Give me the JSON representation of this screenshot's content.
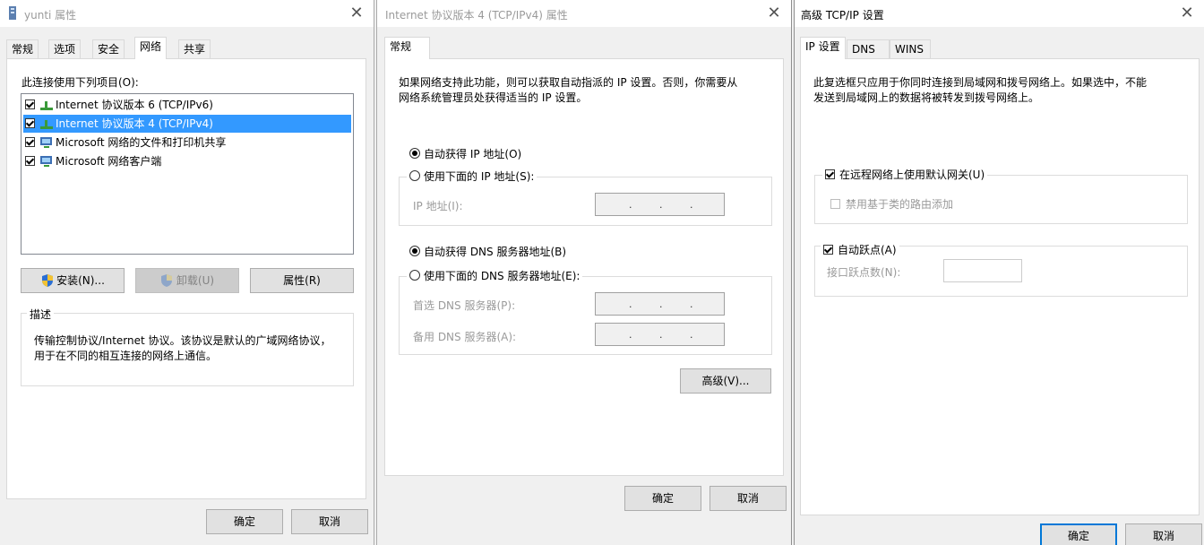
{
  "win1": {
    "title": "yunti 属性",
    "tabs": [
      "常规",
      "选项",
      "安全",
      "网络",
      "共享"
    ],
    "list_label": "此连接使用下列项目(O):",
    "items": [
      {
        "label": "Internet 协议版本 6 (TCP/IPv6)",
        "checked": true
      },
      {
        "label": "Internet 协议版本 4 (TCP/IPv4)",
        "checked": true
      },
      {
        "label": "Microsoft 网络的文件和打印机共享",
        "checked": true
      },
      {
        "label": "Microsoft 网络客户端",
        "checked": true
      }
    ],
    "install_label": "安装(N)...",
    "uninstall_label": "卸载(U)",
    "properties_label": "属性(R)",
    "desc_title": "描述",
    "desc_line1": "传输控制协议/Internet 协议。该协议是默认的广域网络协议，",
    "desc_line2": "用于在不同的相互连接的网络上通信。",
    "ok_label": "确定",
    "cancel_label": "取消"
  },
  "win2": {
    "title": "Internet 协议版本 4 (TCP/IPv4) 属性",
    "tab": "常规",
    "intro_line1": "如果网络支持此功能，则可以获取自动指派的 IP 设置。否则，你需要从",
    "intro_line2": "网络系统管理员处获得适当的 IP 设置。",
    "auto_ip": "自动获得 IP 地址(O)",
    "manual_ip": "使用下面的 IP 地址(S):",
    "ip_label": "IP 地址(I):",
    "auto_dns": "自动获得 DNS 服务器地址(B)",
    "manual_dns": "使用下面的 DNS 服务器地址(E):",
    "pref_dns": "首选 DNS 服务器(P):",
    "alt_dns": "备用 DNS 服务器(A):",
    "advanced_label": "高级(V)...",
    "ok_label": "确定",
    "cancel_label": "取消"
  },
  "win3": {
    "title": "高级 TCP/IP 设置",
    "tabs": [
      "IP 设置",
      "DNS",
      "WINS"
    ],
    "desc_line1": "此复选框只应用于你同时连接到局域网和拨号网络上。如果选中，不能",
    "desc_line2": "发送到局域网上的数据将被转发到拨号网络上。",
    "use_gateway": "在远程网络上使用默认网关(U)",
    "disable_class": "禁用基于类的路由添加",
    "auto_metric": "自动跃点(A)",
    "metric_label": "接口跃点数(N):",
    "ok_label": "确定",
    "cancel_label": "取消"
  },
  "colors": {
    "selection": "#3399ff",
    "panel": "#ffffff",
    "dialog": "#f0f0f0"
  }
}
